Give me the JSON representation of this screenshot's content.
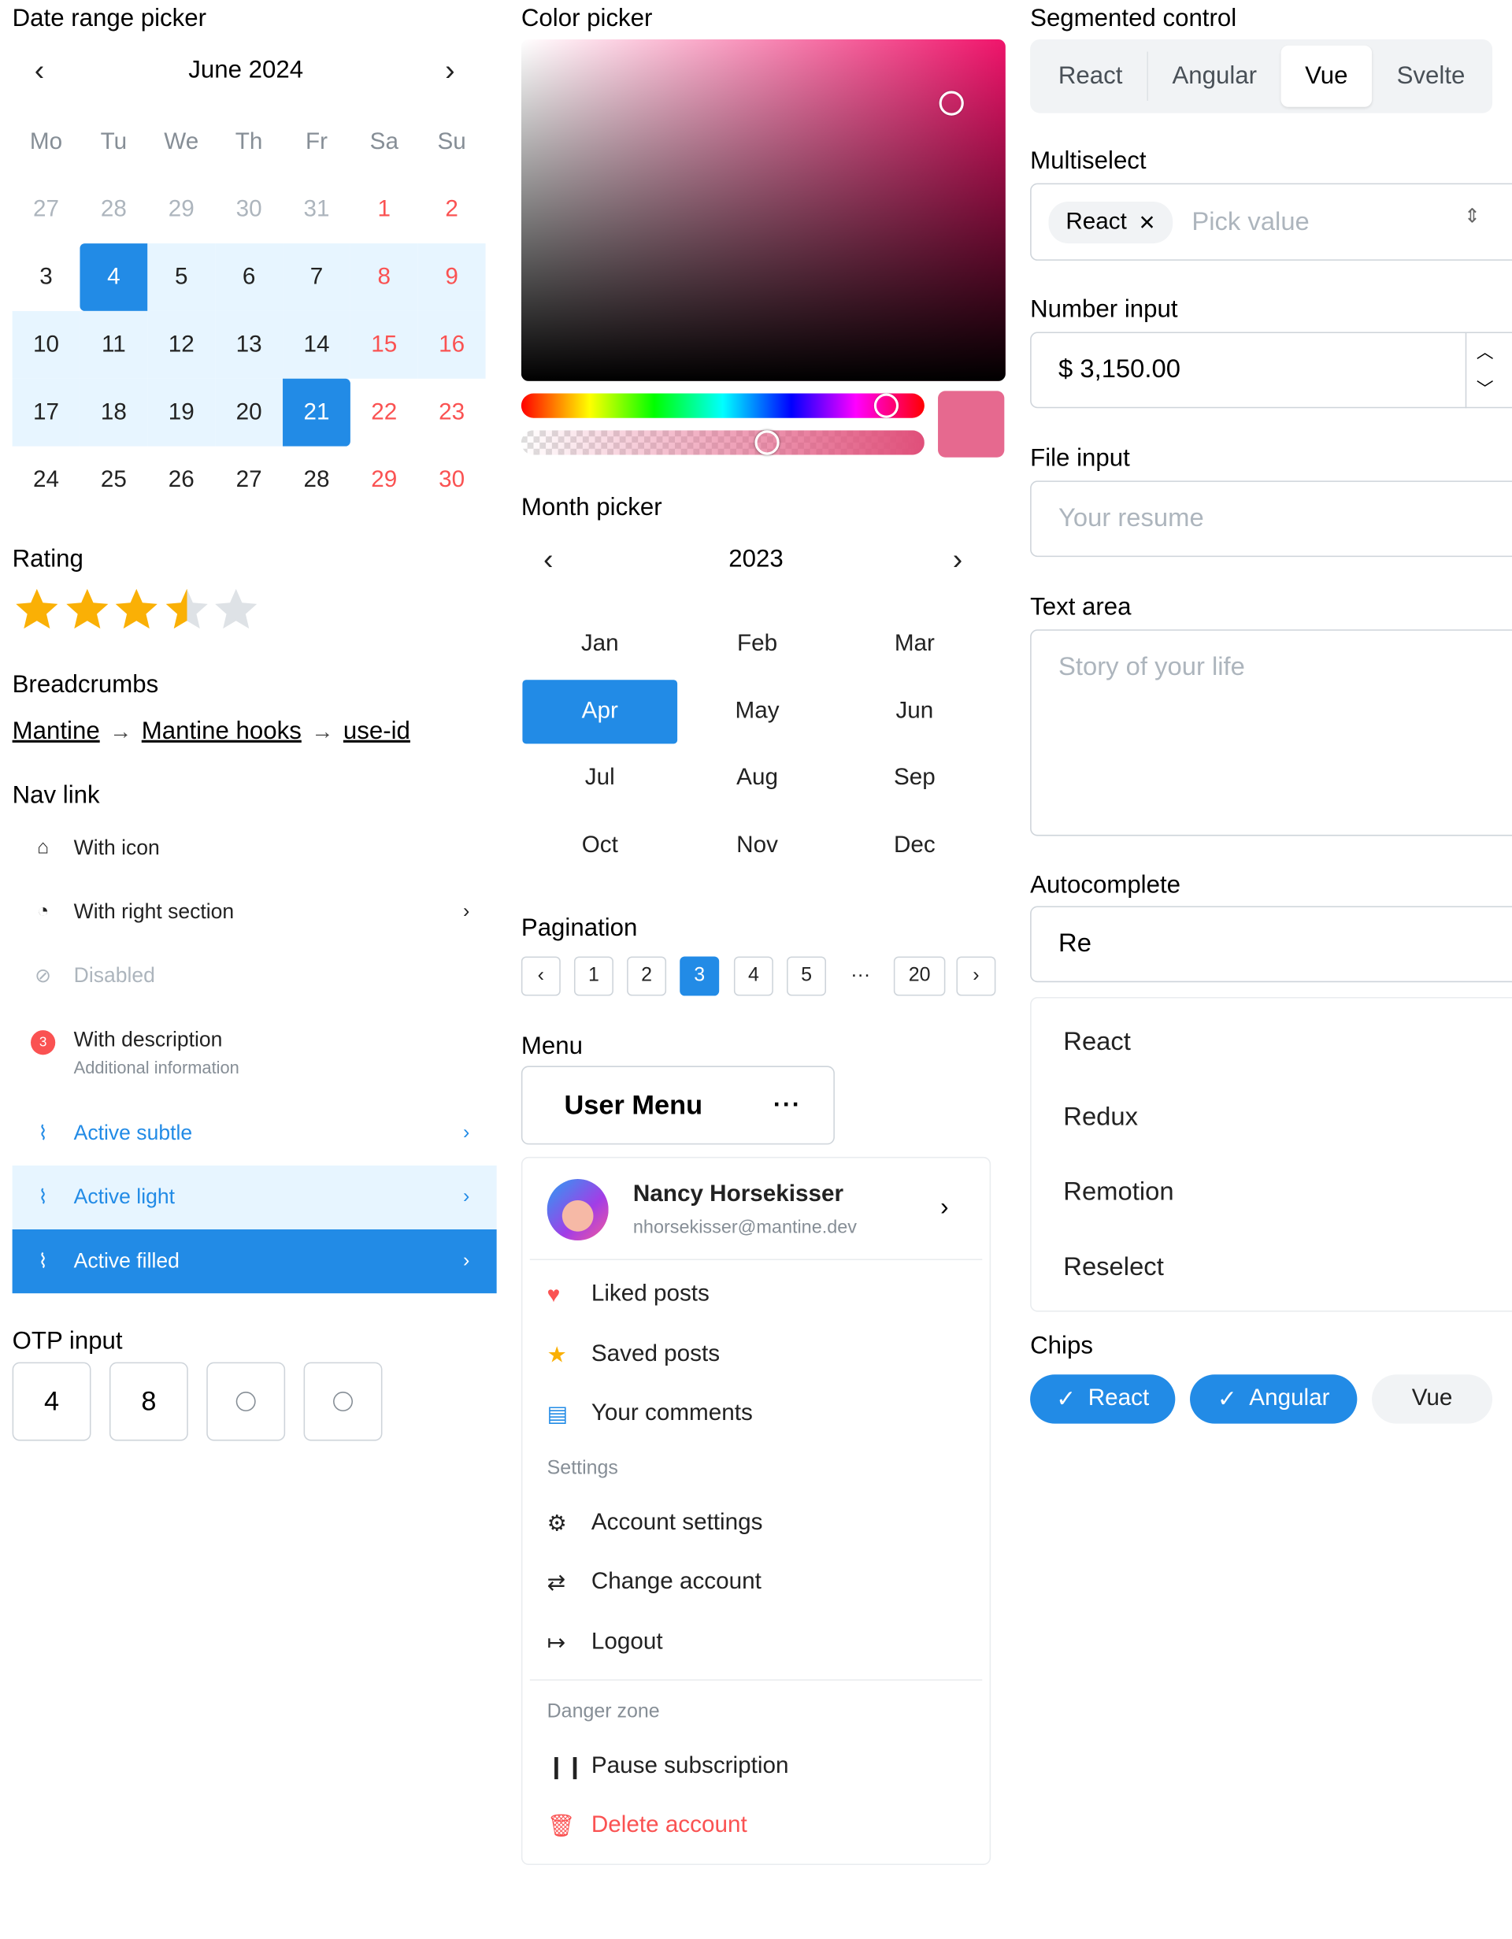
{
  "date_picker": {
    "title": "Date range picker",
    "month": "June 2024",
    "weekdays": [
      "Mo",
      "Tu",
      "We",
      "Th",
      "Fr",
      "Sa",
      "Su"
    ],
    "weeks": [
      [
        "27",
        "28",
        "29",
        "30",
        "31",
        "1",
        "2"
      ],
      [
        "3",
        "4",
        "5",
        "6",
        "7",
        "8",
        "9"
      ],
      [
        "10",
        "11",
        "12",
        "13",
        "14",
        "15",
        "16"
      ],
      [
        "17",
        "18",
        "19",
        "20",
        "21",
        "22",
        "23"
      ],
      [
        "24",
        "25",
        "26",
        "27",
        "28",
        "29",
        "30"
      ]
    ],
    "range_start": "4",
    "range_end": "21"
  },
  "rating": {
    "title": "Rating",
    "value": 3.5,
    "max": 5,
    "color": "#fab005"
  },
  "breadcrumbs": {
    "title": "Breadcrumbs",
    "items": [
      "Mantine",
      "Mantine hooks",
      "use-id"
    ]
  },
  "nav_links": {
    "title": "Nav link",
    "items": [
      {
        "label": "With icon"
      },
      {
        "label": "With right section"
      },
      {
        "label": "Disabled"
      },
      {
        "label": "With description",
        "description": "Additional information",
        "badge": "3"
      },
      {
        "label": "Active subtle"
      },
      {
        "label": "Active light"
      },
      {
        "label": "Active filled"
      }
    ]
  },
  "otp": {
    "title": "OTP input",
    "values": [
      "4",
      "8",
      "",
      ""
    ]
  },
  "color_picker": {
    "title": "Color picker",
    "color": "#e35983"
  },
  "month_picker": {
    "title": "Month picker",
    "year": "2023",
    "months": [
      "Jan",
      "Feb",
      "Mar",
      "Apr",
      "May",
      "Jun",
      "Jul",
      "Aug",
      "Sep",
      "Oct",
      "Nov",
      "Dec"
    ],
    "selected": "Apr"
  },
  "pagination": {
    "title": "Pagination",
    "pages": [
      "1",
      "2",
      "3",
      "4",
      "5",
      "20"
    ],
    "active": "3",
    "dots": "···"
  },
  "menu": {
    "title": "Menu",
    "button_label": "User Menu",
    "more": "···",
    "user_name": "Nancy Horsekisser",
    "user_email": "nhorsekisser@mantine.dev",
    "items": [
      "Liked posts",
      "Saved posts",
      "Your comments"
    ],
    "settings_label": "Settings",
    "settings_items": [
      "Account settings",
      "Change account",
      "Logout"
    ],
    "danger_label": "Danger zone",
    "danger_items": [
      "Pause subscription",
      "Delete account"
    ]
  },
  "segmented": {
    "title": "Segmented control",
    "items": [
      "React",
      "Angular",
      "Vue",
      "Svelte"
    ],
    "active": "Vue"
  },
  "multiselect": {
    "title": "Multiselect",
    "selected": "React",
    "placeholder": "Pick value"
  },
  "number_input": {
    "title": "Number input",
    "value": "$ 3,150.00"
  },
  "file_input": {
    "title": "File input",
    "placeholder": "Your resume"
  },
  "text_area": {
    "title": "Text area",
    "placeholder": "Story of your life"
  },
  "autocomplete": {
    "title": "Autocomplete",
    "value": "Re",
    "options": [
      "React",
      "Redux",
      "Remotion",
      "Reselect"
    ]
  },
  "chips": {
    "title": "Chips",
    "items": [
      "React",
      "Angular",
      "Vue"
    ],
    "checked": [
      "React",
      "Angular"
    ]
  },
  "colors": {
    "primary": "#228be6",
    "primary_light": "#e7f5ff",
    "danger": "#fa5252",
    "star": "#fab005"
  }
}
